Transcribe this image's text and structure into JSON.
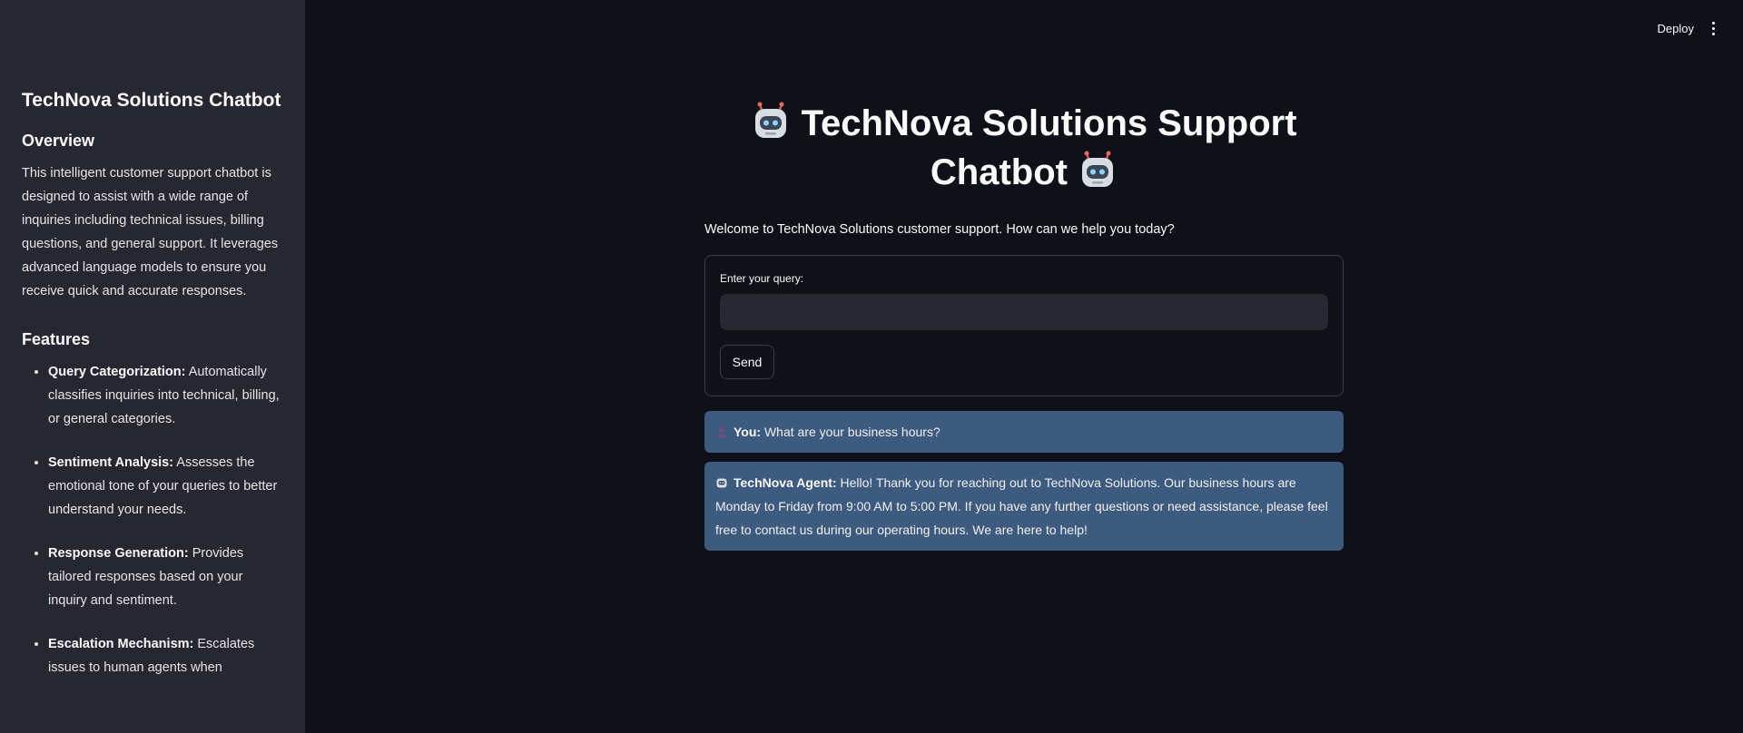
{
  "sidebar": {
    "title": "TechNova Solutions Chatbot",
    "overview_heading": "Overview",
    "overview_text": "This intelligent customer support chatbot is designed to assist with a wide range of inquiries including technical issues, billing questions, and general support. It leverages advanced language models to ensure you receive quick and accurate responses.",
    "features_heading": "Features",
    "features": [
      {
        "name": "Query Categorization:",
        "text": " Automatically classifies inquiries into technical, billing, or general categories."
      },
      {
        "name": "Sentiment Analysis:",
        "text": " Assesses the emotional tone of your queries to better understand your needs."
      },
      {
        "name": "Response Generation:",
        "text": " Provides tailored responses based on your inquiry and sentiment."
      },
      {
        "name": "Escalation Mechanism:",
        "text": " Escalates issues to human agents when"
      }
    ]
  },
  "header": {
    "deploy_label": "Deploy",
    "menu_icon": "kebab-menu-icon"
  },
  "main": {
    "title": "TechNova Solutions Support Chatbot",
    "title_icon": "robot-icon",
    "welcome": "Welcome to TechNova Solutions customer support. How can we help you today?",
    "form": {
      "query_label": "Enter your query:",
      "query_value": "",
      "send_label": "Send"
    },
    "messages": [
      {
        "role_label": "You:",
        "text": " What are your business hours?",
        "icon": "user-icon"
      },
      {
        "role_label": "TechNova Agent:",
        "text": " Hello! Thank you for reaching out to TechNova Solutions. Our business hours are Monday to Friday from 9:00 AM to 5:00 PM. If you have any further questions or need assistance, please feel free to contact us during our operating hours. We are here to help!",
        "icon": "robot-icon"
      }
    ]
  },
  "colors": {
    "background": "#0e1117",
    "sidebar": "#262730",
    "message_bubble": "#3d5a7f",
    "text": "#fafafa"
  }
}
